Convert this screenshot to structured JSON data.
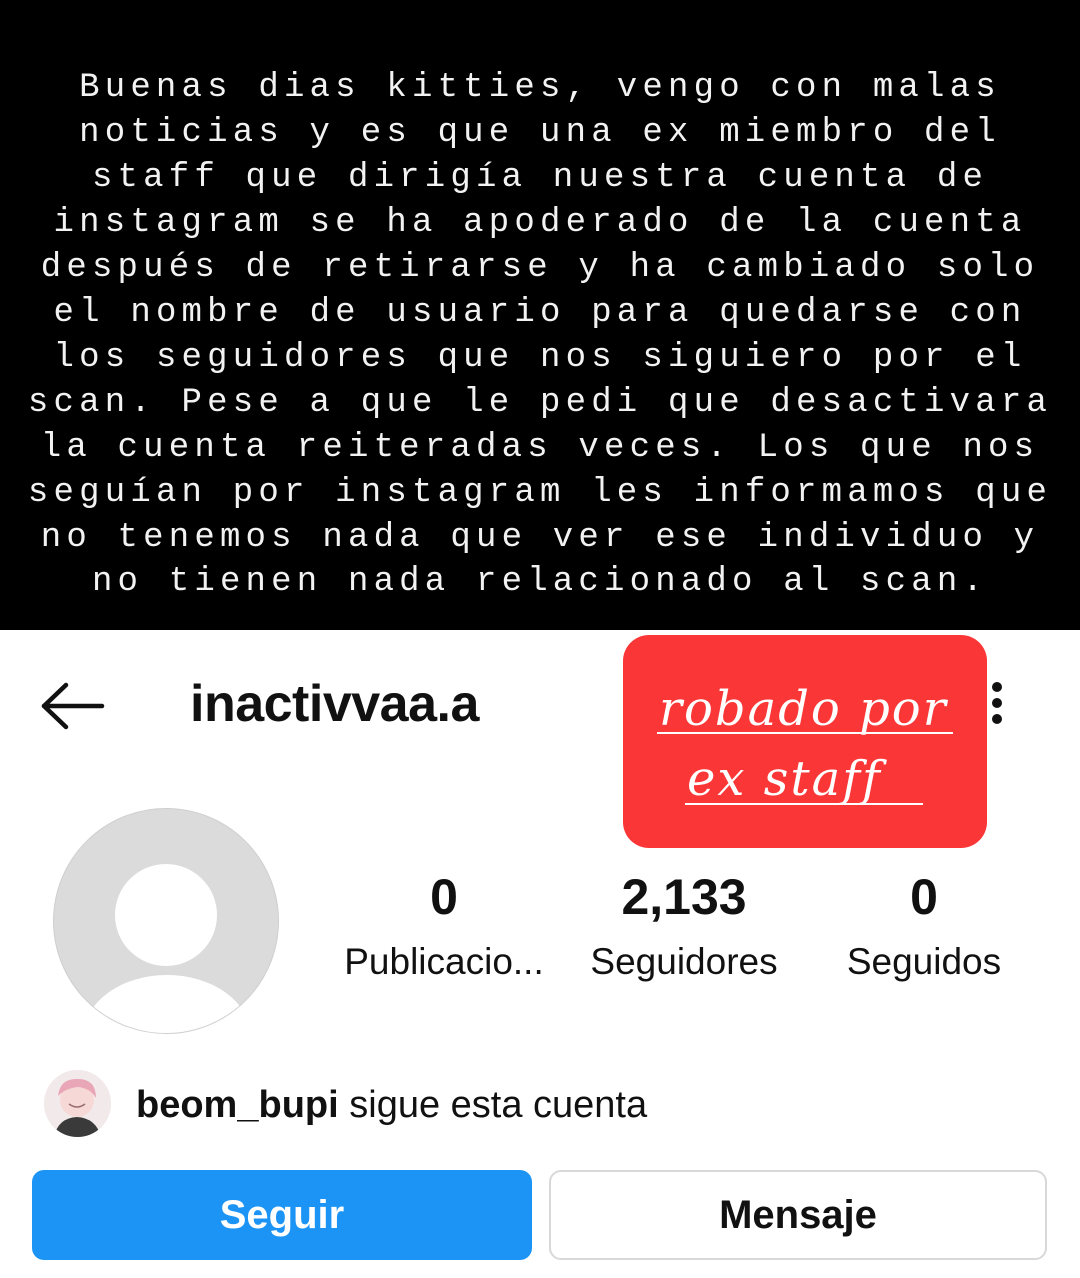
{
  "notice": {
    "lines": [
      "Buenas dias kitties, vengo con malas",
      "noticias y es que una ex miembro del",
      "staff que dirigía nuestra cuenta de",
      "instagram se ha apoderado de la cuenta",
      "después de retirarse y ha cambiado solo",
      "el nombre de usuario para quedarse con",
      "los seguidores que nos siguiero por el",
      "scan. Pese a que le pedi que desactivara",
      "la cuenta reiteradas veces. Los que nos",
      "seguían por instagram les informamos que",
      "no tenemos nada que ver ese individuo y",
      "no tienen nada relacionado al scan."
    ]
  },
  "header": {
    "back_icon": "arrow-left-icon",
    "username": "inactivvaa.a",
    "more_icon": "more-vertical-icon"
  },
  "sticker": {
    "line1": "robado por",
    "line2": "ex staff",
    "color": "#fb3637"
  },
  "profile": {
    "avatar_icon": "default-avatar-icon",
    "stats": {
      "posts": {
        "value": "0",
        "label": "Publicacio..."
      },
      "followers": {
        "value": "2,133",
        "label": "Seguidores"
      },
      "following": {
        "value": "0",
        "label": "Seguidos"
      }
    }
  },
  "followed_by": {
    "username": "beom_bupi",
    "text": " sigue esta cuenta"
  },
  "actions": {
    "follow_label": "Seguir",
    "message_label": "Mensaje",
    "follow_color": "#1b94f5"
  }
}
